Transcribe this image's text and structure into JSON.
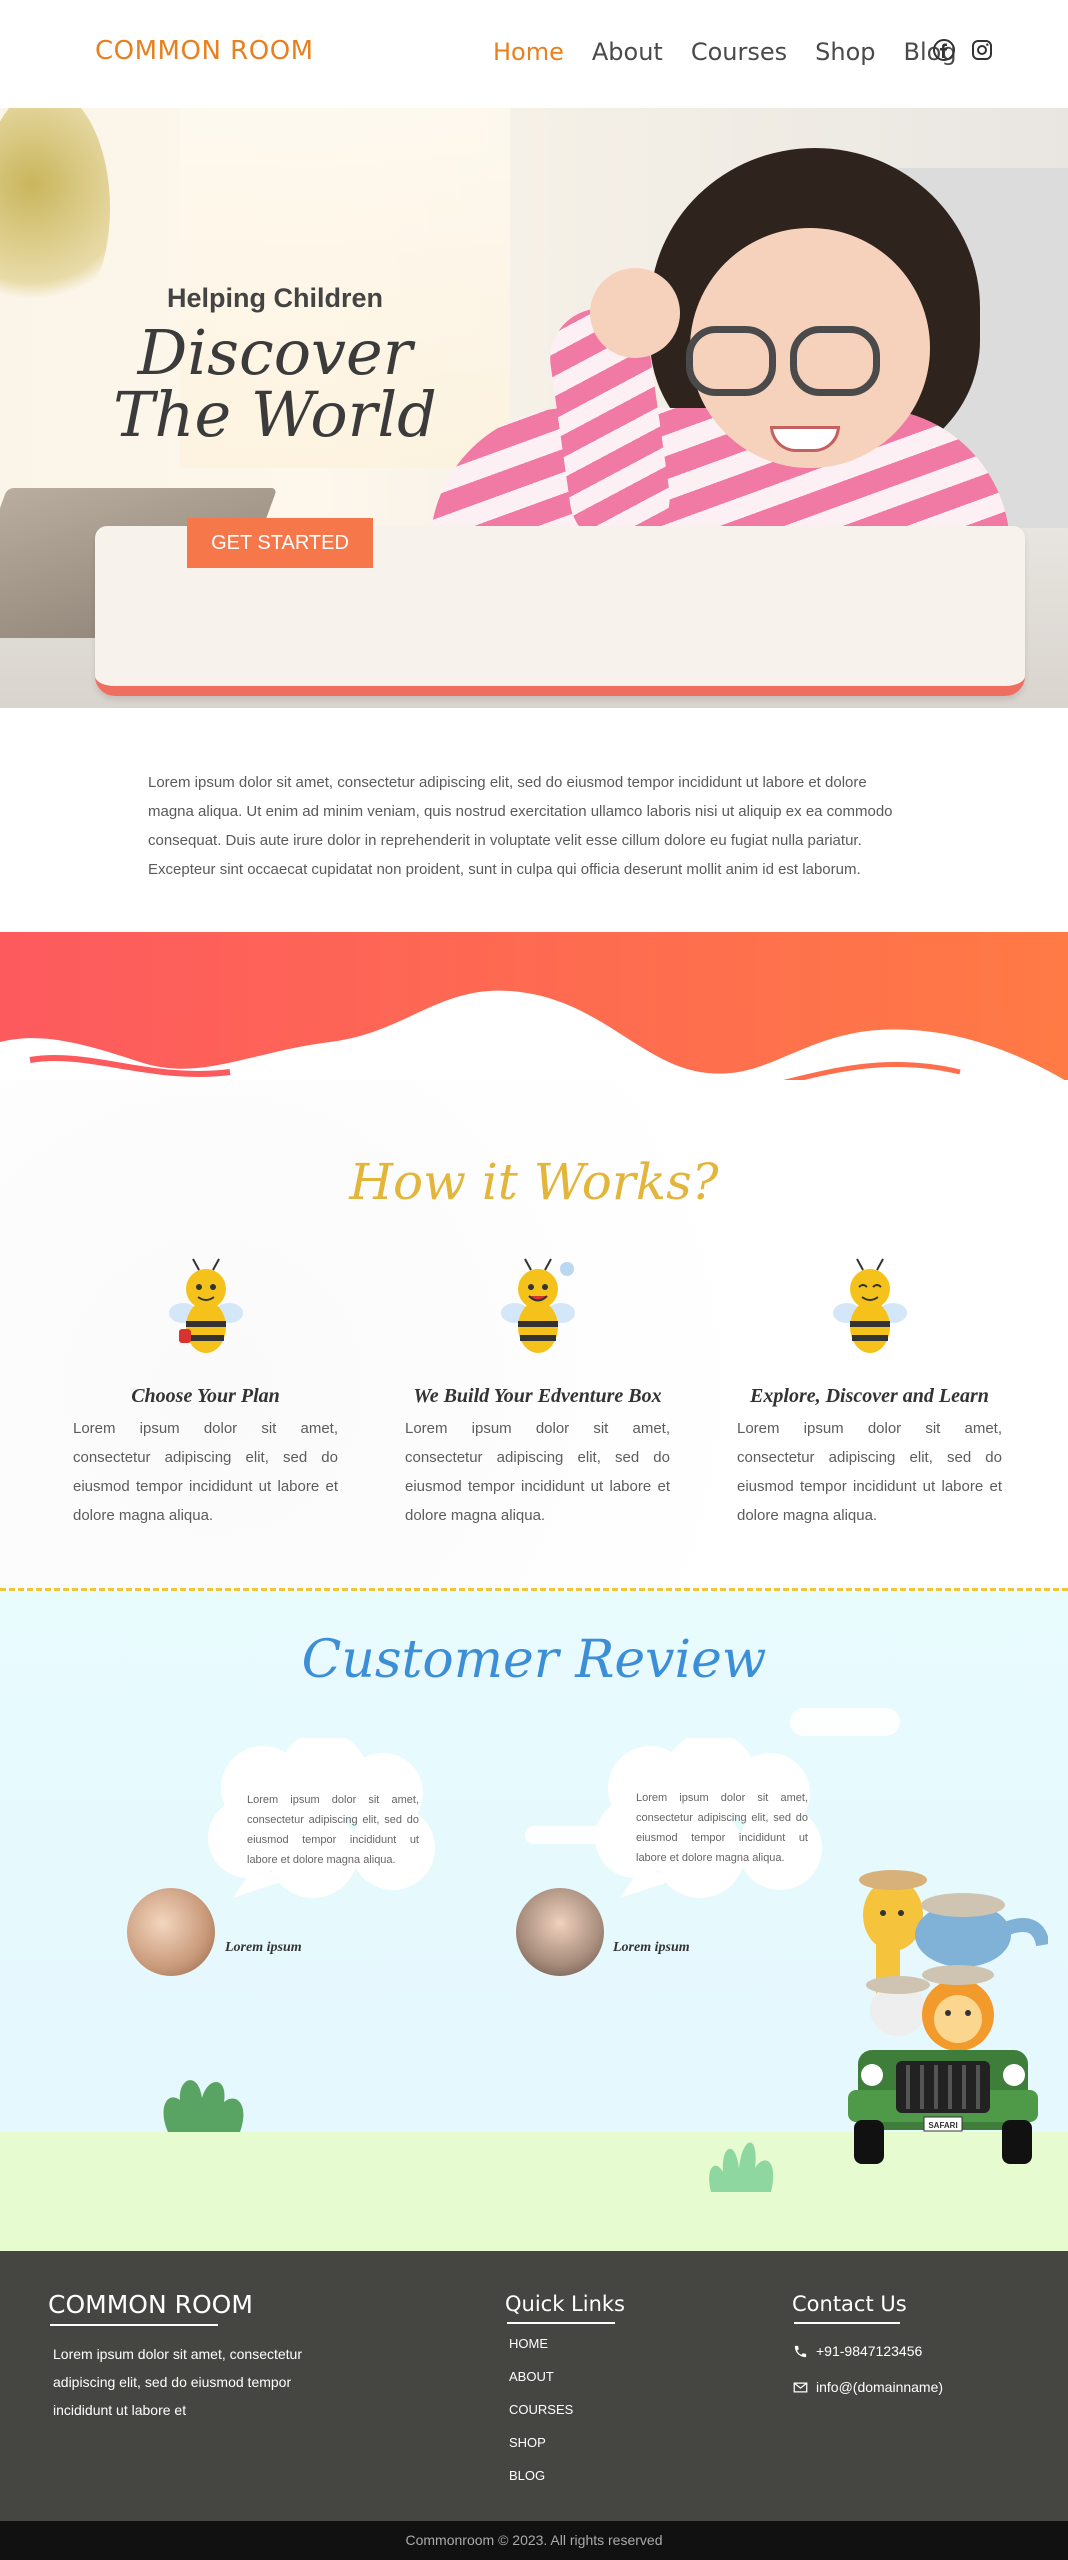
{
  "header": {
    "logo": "COMMON ROOM",
    "nav": [
      {
        "label": "Home",
        "active": true
      },
      {
        "label": "About",
        "active": false
      },
      {
        "label": "Courses",
        "active": false
      },
      {
        "label": "Shop",
        "active": false
      },
      {
        "label": "Blog",
        "active": false
      }
    ],
    "social_icons": [
      "facebook-icon",
      "instagram-icon"
    ],
    "accent_color": "#e8801f"
  },
  "hero": {
    "subtitle": "Helping Children",
    "title": "Discover The World",
    "cta_label": "GET STARTED",
    "cta_color": "#f6774a"
  },
  "intro": {
    "text": "Lorem ipsum dolor sit amet, consectetur adipiscing elit, sed do eiusmod tempor incididunt ut labore et dolore magna aliqua. Ut enim ad minim veniam, quis nostrud exercitation ullamco laboris nisi ut aliquip ex ea commodo consequat. Duis aute irure dolor in reprehenderit in voluptate velit esse cillum dolore eu fugiat nulla pariatur. Excepteur sint occaecat cupidatat non proident, sunt in culpa qui officia deserunt mollit anim id est laborum."
  },
  "how_it_works": {
    "title": "How it Works?",
    "title_color": "#e3b53b",
    "steps": [
      {
        "title": "Choose Your Plan",
        "text": "Lorem ipsum dolor sit amet, consectetur adipiscing elit, sed do eiusmod tempor incididunt ut labore et dolore magna aliqua."
      },
      {
        "title": "We Build Your Edventure Box",
        "text": "Lorem ipsum dolor sit amet, consectetur adipiscing elit, sed do eiusmod tempor incididunt ut labore et dolore magna aliqua."
      },
      {
        "title": "Explore, Discover and Learn",
        "text": "Lorem ipsum dolor sit amet, consectetur adipiscing elit, sed do eiusmod tempor incididunt ut labore et dolore magna aliqua."
      }
    ]
  },
  "reviews": {
    "title": "Customer Review",
    "title_color": "#3c8fd7",
    "items": [
      {
        "text": "Lorem ipsum dolor sit amet, consectetur adipiscing elit, sed do eiusmod tempor incididunt ut labore et dolore magna aliqua.",
        "name": "Lorem ipsum"
      },
      {
        "text": "Lorem ipsum dolor sit amet, consectetur adipiscing elit, sed do eiusmod tempor incididunt ut labore et dolore magna aliqua.",
        "name": "Lorem ipsum"
      }
    ],
    "jeep_plate": "SAFARI"
  },
  "footer": {
    "logo": "COMMON ROOM",
    "about": "Lorem ipsum dolor sit amet, consectetur adipiscing elit, sed do eiusmod tempor incididunt ut labore et",
    "quick_links_title": "Quick Links",
    "quick_links": [
      "HOME",
      "ABOUT",
      "COURSES",
      "SHOP",
      "BLOG"
    ],
    "contact_title": "Contact Us",
    "phone": "+91-9847123456",
    "email": "info@(domainname)",
    "copyright": "Commonroom © 2023. All rights reserved"
  }
}
